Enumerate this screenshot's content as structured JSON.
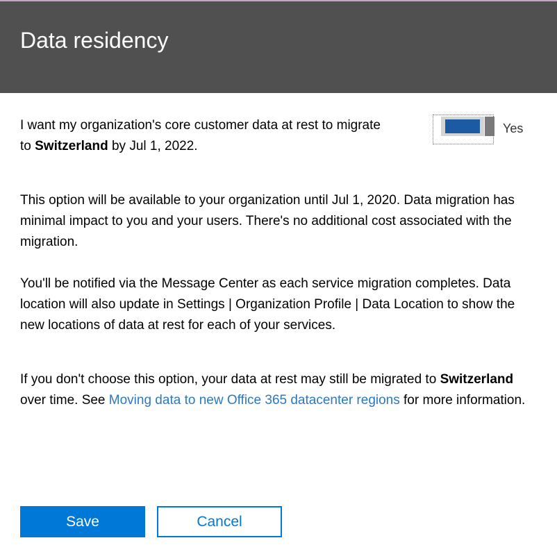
{
  "header": {
    "title": "Data residency"
  },
  "option": {
    "text_before": "I want my organization's core customer data at rest to migrate to ",
    "location": "Switzerland",
    "text_after": " by Jul 1, 2022.",
    "toggle_label": "Yes",
    "toggle_state": "on"
  },
  "info": {
    "availability": "This option will be available to your organization until Jul 1, 2020. Data migration has minimal impact to you and your users. There's no additional cost associated with the migration.",
    "notification": "You'll be notified via the Message Center as each service migration completes. Data location will also update in Settings | Organization Profile | Data Location to show the new locations of data at rest for each of your services.",
    "fallback_before": "If you don't choose this option, your data at rest may still be migrated to ",
    "fallback_location": "Switzerland",
    "fallback_middle": " over time. See ",
    "fallback_link": "Moving data to new Office 365 datacenter regions",
    "fallback_after": " for more information."
  },
  "actions": {
    "save_label": "Save",
    "cancel_label": "Cancel"
  },
  "colors": {
    "header_bg": "#505050",
    "accent": "#0078d7",
    "link": "#2b78c2",
    "toggle_fill": "#1d5aa4"
  }
}
